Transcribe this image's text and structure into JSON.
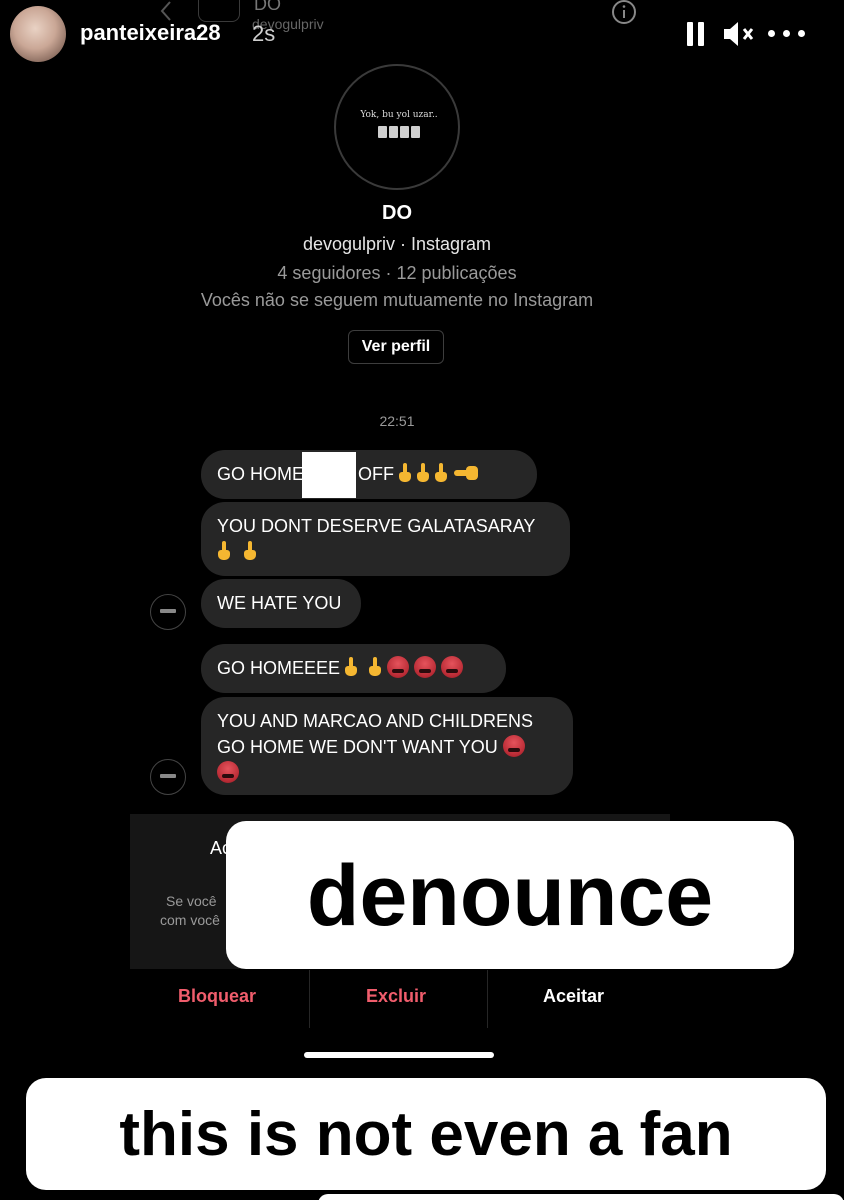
{
  "story": {
    "username": "panteixeira28",
    "time_ago": "2s"
  },
  "dm_header": {
    "name": "DO",
    "username": "devogulpriv"
  },
  "profile": {
    "picture_caption": "Yok, bu yol uzar..",
    "name": "DO",
    "handle_line": "devogulpriv · Instagram",
    "stats_line": "4 seguidores · 12 publicações",
    "mutual_line": "Vocês não se seguem mutuamente no Instagram",
    "view_profile_label": "Ver perfil"
  },
  "messages": {
    "timestamp": "22:51",
    "m1_a": "GO HOME",
    "m1_b": "OFF",
    "m2": "YOU DONT DESERVE GALATASARAY",
    "m3": "WE HATE YOU",
    "m4": "GO HOMEEEE",
    "m5_line1": "YOU AND MARCAO AND CHILDRENS",
    "m5_line2": "GO HOME WE DON'T WANT YOU"
  },
  "request": {
    "title_partial": "Ac",
    "line1_partial": "Se você",
    "line2_partial": "com você",
    "block_label": "Bloquear",
    "delete_label": "Excluir",
    "accept_label": "Aceitar"
  },
  "stickers": {
    "denounce": "denounce",
    "not_fan": "this is not even a fan"
  },
  "colors": {
    "background": "#000000",
    "bubble": "#262626",
    "destructive": "#f05d6c",
    "emoji_yellow": "#f5b731"
  }
}
